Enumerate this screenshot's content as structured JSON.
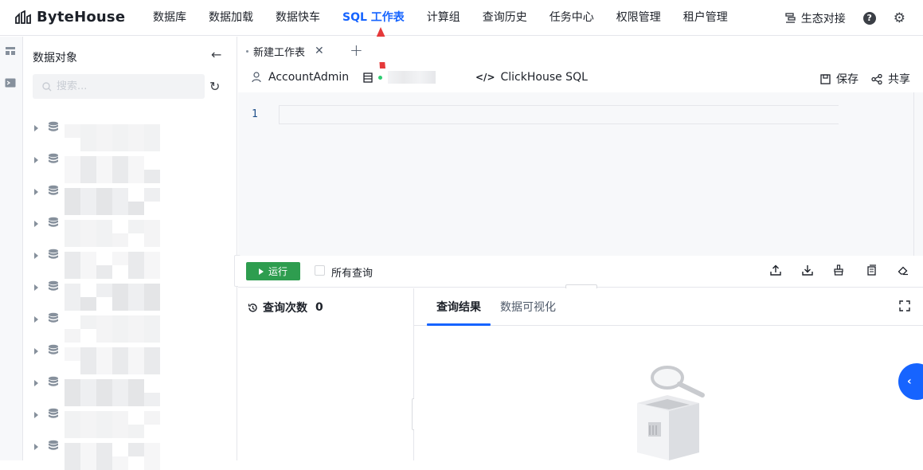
{
  "brand": {
    "name": "ByteHouse"
  },
  "nav": {
    "items": [
      "数据库",
      "数据加载",
      "数据快车",
      "SQL 工作表",
      "计算组",
      "查询历史",
      "任务中心",
      "权限管理",
      "租户管理"
    ],
    "active": "SQL 工作表",
    "right": {
      "eco_label": "生态对接",
      "help_icon": "help-circle-icon",
      "settings_icon": "gear-icon"
    }
  },
  "object_panel": {
    "title": "数据对象",
    "search_placeholder": "搜索...",
    "tree_row_count_visible": 11
  },
  "worksheet_tabs": {
    "tabs": [
      {
        "label": "新建工作表"
      }
    ],
    "add_icon": "plus-icon"
  },
  "toolbar": {
    "user": "AccountAdmin",
    "dialect": "ClickHouse SQL",
    "save": "保存",
    "share": "共享"
  },
  "editor": {
    "line_numbers": [
      "1"
    ]
  },
  "runbar": {
    "run": "运行",
    "all_queries": "所有查询"
  },
  "history": {
    "label": "查询次数",
    "count": "0"
  },
  "results": {
    "tabs": [
      "查询结果",
      "数据可视化"
    ],
    "active_tab": "查询结果"
  },
  "colors": {
    "accent": "#1664ff",
    "run_green": "#2e9d4f",
    "annotation_red": "#e5393a"
  }
}
